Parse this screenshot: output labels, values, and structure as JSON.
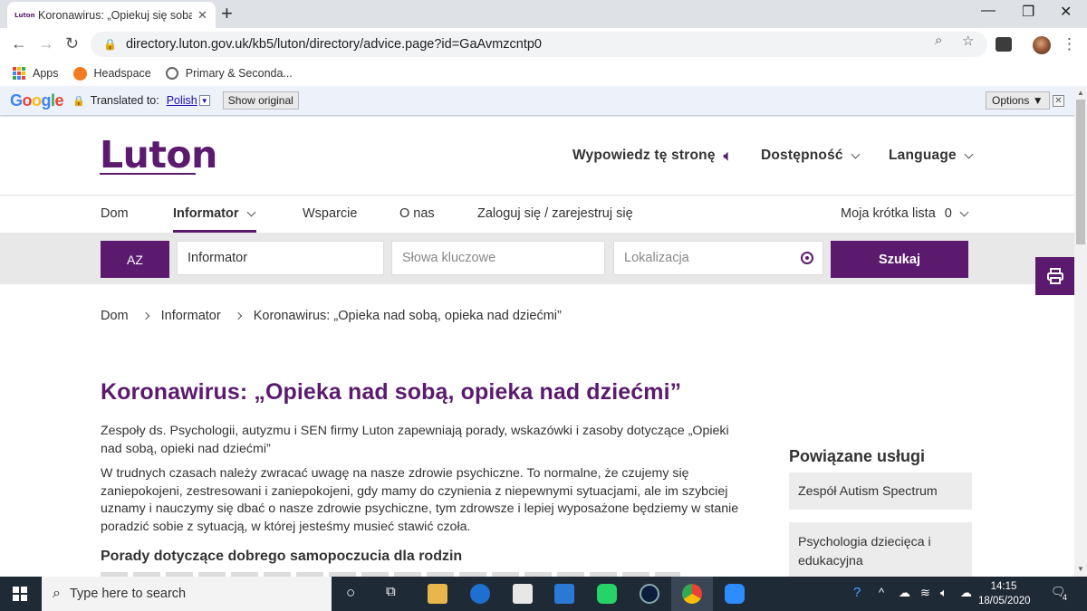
{
  "browser": {
    "tab_favicon_text": "Luton",
    "tab_title": "Koronawirus: „Opiekuj się sobą, o",
    "url": "directory.luton.gov.uk/kb5/luton/directory/advice.page?id=GaAvmzcntp0",
    "bookmarks": [
      {
        "label": "Apps",
        "icon": "apps-grid-icon"
      },
      {
        "label": "Headspace",
        "icon": "headspace-icon"
      },
      {
        "label": "Primary & Seconda...",
        "icon": "globe-icon"
      }
    ]
  },
  "translate_bar": {
    "logo": "Google",
    "translated_to": "Translated to:",
    "language": "Polish",
    "show_original": "Show original",
    "options": "Options ▼"
  },
  "header": {
    "logo": "Luton",
    "read_page": "Wypowiedz tę stronę",
    "accessibility": "Dostępność",
    "language": "Language"
  },
  "nav": {
    "items": [
      "Dom",
      "Informator",
      "Wsparcie",
      "O nas",
      "Zaloguj się / zarejestruj się"
    ],
    "shortlist_label": "Moja krótka lista",
    "shortlist_count": "0"
  },
  "search": {
    "az_label": "AZ",
    "directory_value": "Informator",
    "keywords_placeholder": "Słowa kluczowe",
    "location_placeholder": "Lokalizacja",
    "submit_label": "Szukaj"
  },
  "breadcrumb": [
    "Dom",
    "Informator",
    "Koronawirus: „Opieka nad sobą, opieka nad dziećmi”"
  ],
  "content": {
    "title": "Koronawirus: „Opieka nad sobą, opieka nad dziećmi”",
    "paragraph1": "Zespoły ds. Psychologii, autyzmu i SEN firmy Luton zapewniają porady, wskazówki i zasoby dotyczące „Opieki nad sobą, opieki nad dziećmi”",
    "paragraph2": "W trudnych czasach należy zwracać uwagę na nasze zdrowie psychiczne. To normalne, że czujemy się zaniepokojeni, zestresowani i zaniepokojeni, gdy mamy do czynienia z niepewnymi sytuacjami, ale im szybciej uznamy i nauczymy się dbać o nasze zdrowie psychiczne, tym zdrowsze i lepiej wyposażone będziemy w stanie poradzić sobie z sytuacją, w której jesteśmy musieć stawić czoła.",
    "subheading": "Porady dotyczące dobrego samopoczucia dla rodzin"
  },
  "sidebar": {
    "title": "Powiązane usługi",
    "items": [
      "Zespół Autism Spectrum",
      "Psychologia dziecięca i edukacyjna"
    ]
  },
  "taskbar": {
    "search_placeholder": "Type here to search",
    "time": "14:15",
    "date": "18/05/2020",
    "notifications": "4"
  },
  "colors": {
    "brand_purple": "#5b1a6e",
    "search_band": "#e8e8e8",
    "taskbar": "#1f2a37"
  }
}
